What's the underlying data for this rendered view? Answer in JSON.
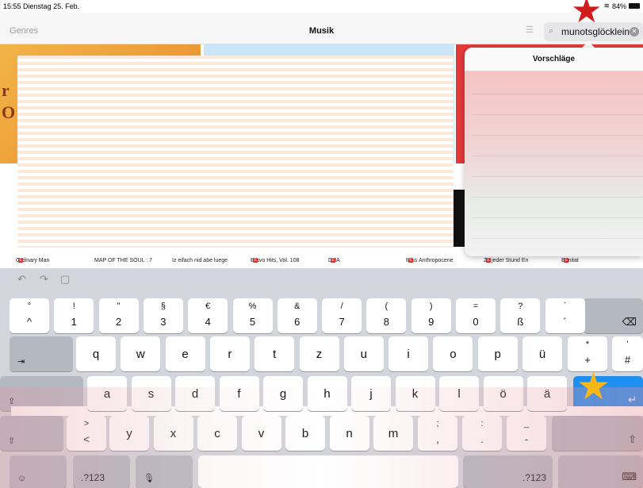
{
  "status": {
    "time": "15:55",
    "date": "Dienstag 25. Feb.",
    "battery": "84%"
  },
  "nav": {
    "genres": "Genres",
    "title": "Musik",
    "search_value": "munotsglöcklein"
  },
  "banner": {
    "text_line1": "r",
    "text_line2": "O"
  },
  "albums": [
    {
      "title": "Ordinary Man",
      "explicit": "E"
    },
    {
      "title": "MAP OF THE SOUL : 7",
      "explicit": ""
    },
    {
      "title": "Iz eifach nid abe luege",
      "explicit": ""
    },
    {
      "title": "Bravo Hits, Vol. 108",
      "explicit": "E"
    },
    {
      "title": "DNA",
      "explicit": "E"
    },
    {
      "title": "Miss Anthropocene",
      "explicit": "E"
    },
    {
      "title": "Zu jeder Stund En",
      "explicit": "E"
    },
    {
      "title": "Bonitat",
      "explicit": "E"
    }
  ],
  "suggestions": {
    "title": "Vorschläge"
  },
  "keyboard": {
    "row1": [
      {
        "top": "°",
        "bottom": "^"
      },
      {
        "top": "!",
        "bottom": "1"
      },
      {
        "top": "\"",
        "bottom": "2"
      },
      {
        "top": "§",
        "bottom": "3"
      },
      {
        "top": "€",
        "bottom": "4"
      },
      {
        "top": "%",
        "bottom": "5"
      },
      {
        "top": "&",
        "bottom": "6"
      },
      {
        "top": "/",
        "bottom": "7"
      },
      {
        "top": "(",
        "bottom": "8"
      },
      {
        "top": ")",
        "bottom": "9"
      },
      {
        "top": "=",
        "bottom": "0"
      },
      {
        "top": "?",
        "bottom": "ß"
      },
      {
        "top": "`",
        "bottom": "´"
      }
    ],
    "row2": [
      "q",
      "w",
      "e",
      "r",
      "t",
      "z",
      "u",
      "i",
      "o",
      "p",
      "ü"
    ],
    "row2_extra": [
      {
        "top": "*",
        "bottom": "+"
      },
      {
        "top": "'",
        "bottom": "#"
      }
    ],
    "row3": [
      "a",
      "s",
      "d",
      "f",
      "g",
      "h",
      "j",
      "k",
      "l",
      "ö",
      "ä"
    ],
    "row4_first": {
      "top": ">",
      "bottom": "<"
    },
    "row4": [
      "y",
      "x",
      "c",
      "v",
      "b",
      "n",
      "m"
    ],
    "row4_punct": [
      {
        "top": ";",
        "bottom": ","
      },
      {
        "top": ":",
        "bottom": "."
      },
      {
        "top": "_",
        "bottom": "-"
      }
    ],
    "numkey_left": ".?123",
    "numkey_right": ".?123",
    "icons": {
      "backspace": "⌫",
      "tab": "⇥",
      "caps": "⇪",
      "shift": "⇧",
      "enter": "↵",
      "emoji": "☺",
      "mic": "🎙",
      "hide": "⌨",
      "undo": "↶",
      "redo": "↷",
      "paste": "▢"
    }
  }
}
